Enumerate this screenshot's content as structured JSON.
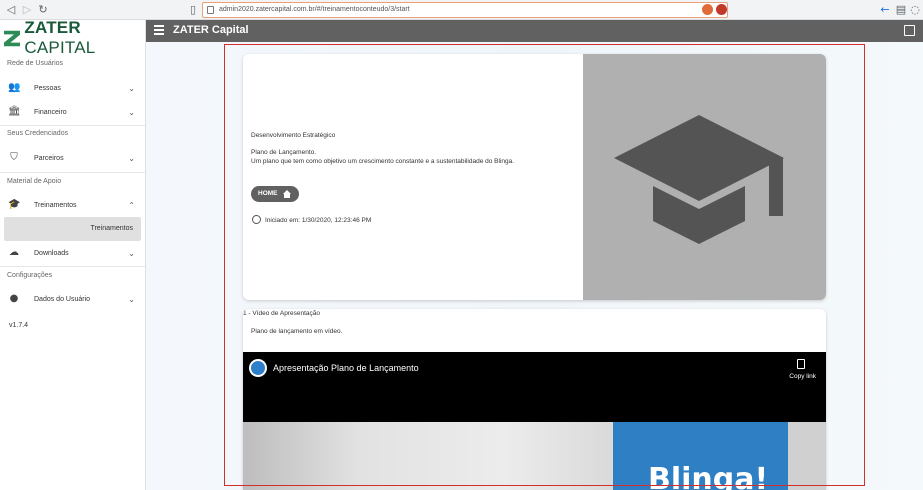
{
  "browser": {
    "url": "admin2020.zatercapital.com.br/#/treinamentoconteudo/3/start"
  },
  "sidebar": {
    "logo_text": "ZATER",
    "logo_text2": "CAPITAL",
    "sections": [
      {
        "label": "Rede de Usuários"
      },
      {
        "label": "Seus Credenciados"
      },
      {
        "label": "Material de Apoio"
      },
      {
        "label": "Configurações"
      }
    ],
    "items": [
      {
        "label": "Pessoas",
        "icon": "people-icon"
      },
      {
        "label": "Financeiro",
        "icon": "bank-icon"
      },
      {
        "label": "Parceiros",
        "icon": "shield-check-icon"
      },
      {
        "label": "Treinamentos",
        "icon": "school-icon"
      },
      {
        "label": "Downloads",
        "icon": "cloud-download-icon"
      },
      {
        "label": "Dados do Usuário",
        "icon": "user-icon"
      }
    ],
    "sub_item": "Treinamentos",
    "version": "v1.7.4"
  },
  "appbar": {
    "title": "ZATER Capital"
  },
  "course": {
    "category": "Desenvolvimento Estratégico",
    "title": "Plano de Lançamento.",
    "description": "Um plano que tem como objetivo um crescimento constante e a sustentabilidade do Blinga.",
    "home_label": "HOME",
    "started_at": "Iniciado em: 1/30/2020, 12:23:46 PM"
  },
  "lesson": {
    "heading": "1 - Vídeo de Apresentação",
    "description": "Plano de lançamento em vídeo.",
    "video_title": "Apresentação Plano de Lançamento",
    "copy_label": "Copy link",
    "brand_text": "Blinga!"
  },
  "colors": {
    "appbar": "#616161",
    "highlight_frame": "#d32f2f",
    "logo_green": "#1a5a3a"
  }
}
